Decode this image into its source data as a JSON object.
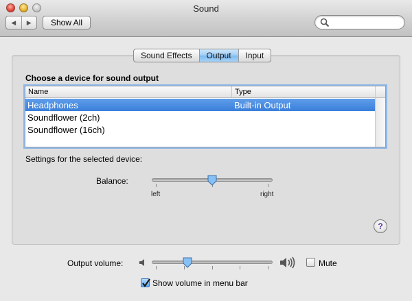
{
  "window": {
    "title": "Sound"
  },
  "toolbar": {
    "back_glyph": "◀",
    "forward_glyph": "▶",
    "show_all_label": "Show All",
    "search_placeholder": ""
  },
  "tabs": [
    {
      "label": "Sound Effects",
      "active": false
    },
    {
      "label": "Output",
      "active": true
    },
    {
      "label": "Input",
      "active": false
    }
  ],
  "output": {
    "heading": "Choose a device for sound output",
    "columns": [
      "Name",
      "Type"
    ],
    "devices": [
      {
        "name": "Headphones",
        "type": "Built-in Output",
        "selected": true
      },
      {
        "name": "Soundflower (2ch)",
        "type": "",
        "selected": false
      },
      {
        "name": "Soundflower (16ch)",
        "type": "",
        "selected": false
      }
    ],
    "settings_label": "Settings for the selected device:",
    "balance": {
      "label": "Balance:",
      "left_label": "left",
      "right_label": "right",
      "value": 0.5
    }
  },
  "footer": {
    "volume_label": "Output volume:",
    "volume_value": 0.27,
    "mute_label": "Mute",
    "mute_checked": false,
    "show_in_menu_label": "Show volume in menu bar",
    "show_in_menu_checked": true
  },
  "help_glyph": "?",
  "icons": {
    "speaker_low": "speaker-low-icon",
    "speaker_high": "speaker-high-icon",
    "search": "search-icon",
    "help": "help-icon"
  },
  "colors": {
    "selection": "#3a7fdb",
    "tab_active": "#9fcdf5",
    "help_text": "#4d2f9a"
  }
}
